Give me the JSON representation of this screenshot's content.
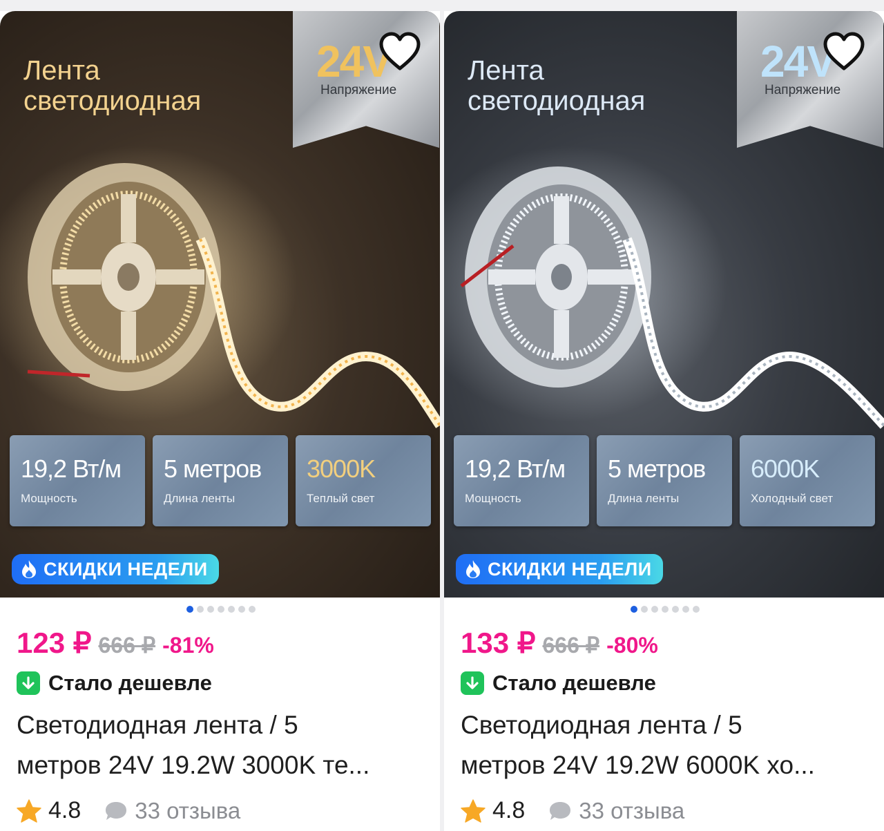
{
  "cards": [
    {
      "image": {
        "title_line1": "Лента",
        "title_line2": "светодиодная",
        "voltage_value": "24V",
        "voltage_label": "Напряжение",
        "specs": [
          {
            "value": "19,2 Вт/м",
            "label": "Мощность"
          },
          {
            "value": "5 метров",
            "label": "Длина ленты"
          },
          {
            "value": "3000K",
            "label": "Теплый свет"
          }
        ],
        "promo": "СКИДКИ НЕДЕЛИ",
        "light_color": "#ffe2a8"
      },
      "gallery_dots": 7,
      "price": "123 ₽",
      "old_price": "666 ₽",
      "discount": "-81%",
      "cheaper": "Стало дешевле",
      "name_line1": "Светодиодная лента / 5",
      "name_line2": "метров 24V 19.2W 3000K те...",
      "rating": "4.8",
      "reviews": "33 отзыва",
      "favorite_icon": "heart-outline-icon"
    },
    {
      "image": {
        "title_line1": "Лента",
        "title_line2": "светодиодная",
        "voltage_value": "24V",
        "voltage_label": "Напряжение",
        "specs": [
          {
            "value": "19,2 Вт/м",
            "label": "Мощность"
          },
          {
            "value": "5 метров",
            "label": "Длина ленты"
          },
          {
            "value": "6000K",
            "label": "Холодный свет"
          }
        ],
        "promo": "СКИДКИ НЕДЕЛИ",
        "light_color": "#eef6ff"
      },
      "gallery_dots": 7,
      "price": "133 ₽",
      "old_price": "666 ₽",
      "discount": "-80%",
      "cheaper": "Стало дешевле",
      "name_line1": "Светодиодная лента / 5",
      "name_line2": "метров 24V 19.2W 6000K хо...",
      "rating": "4.8",
      "reviews": "33 отзыва",
      "favorite_icon": "heart-outline-icon"
    }
  ],
  "colors": {
    "price": "#f0178a",
    "cheaper_badge": "#1fc35a",
    "rating_star": "#f7a826",
    "promo_gradient_start": "#1f6ef5"
  }
}
